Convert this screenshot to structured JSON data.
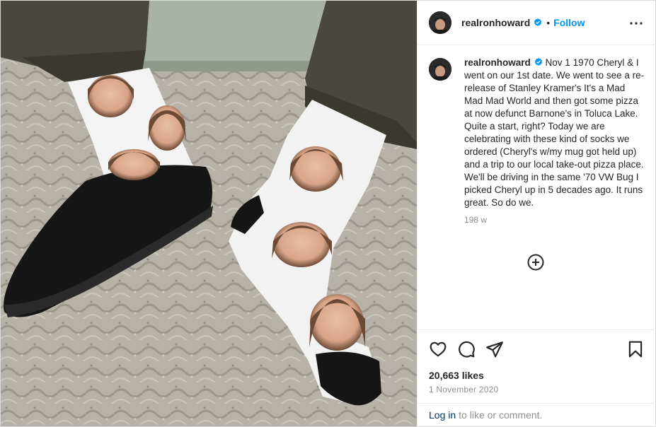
{
  "post": {
    "username": "realronhoward",
    "follow_label": "Follow",
    "separator": "•",
    "caption": "Nov 1 1970 Cheryl & I went on our 1st date. We went to see a re-release of Stanley Kramer's It's a Mad Mad Mad World and then got some pizza at now defunct Barnone's in Toluca Lake. Quite a start, right? Today we are celebrating with these kind of socks we ordered (Cheryl's w/my mug got held up) and a trip to our local take-out pizza place. We'll be driving in the same '70 VW Bug I picked Cheryl up in 5 decades ago. It runs great. So do we.",
    "time_ago": "198 w",
    "likes": "20,663 likes",
    "date": "1 November 2020",
    "login_link": "Log in",
    "login_suffix": "to like or comment."
  },
  "icons": {
    "verified": "verified-badge-icon",
    "more": "more-options-icon",
    "load_more": "plus-circle-icon",
    "like": "heart-icon",
    "comment": "comment-icon",
    "share": "send-icon",
    "save": "bookmark-icon"
  },
  "colors": {
    "accent": "#0095f6",
    "link": "#00376b",
    "muted": "#8e8e8e",
    "text": "#262626"
  }
}
